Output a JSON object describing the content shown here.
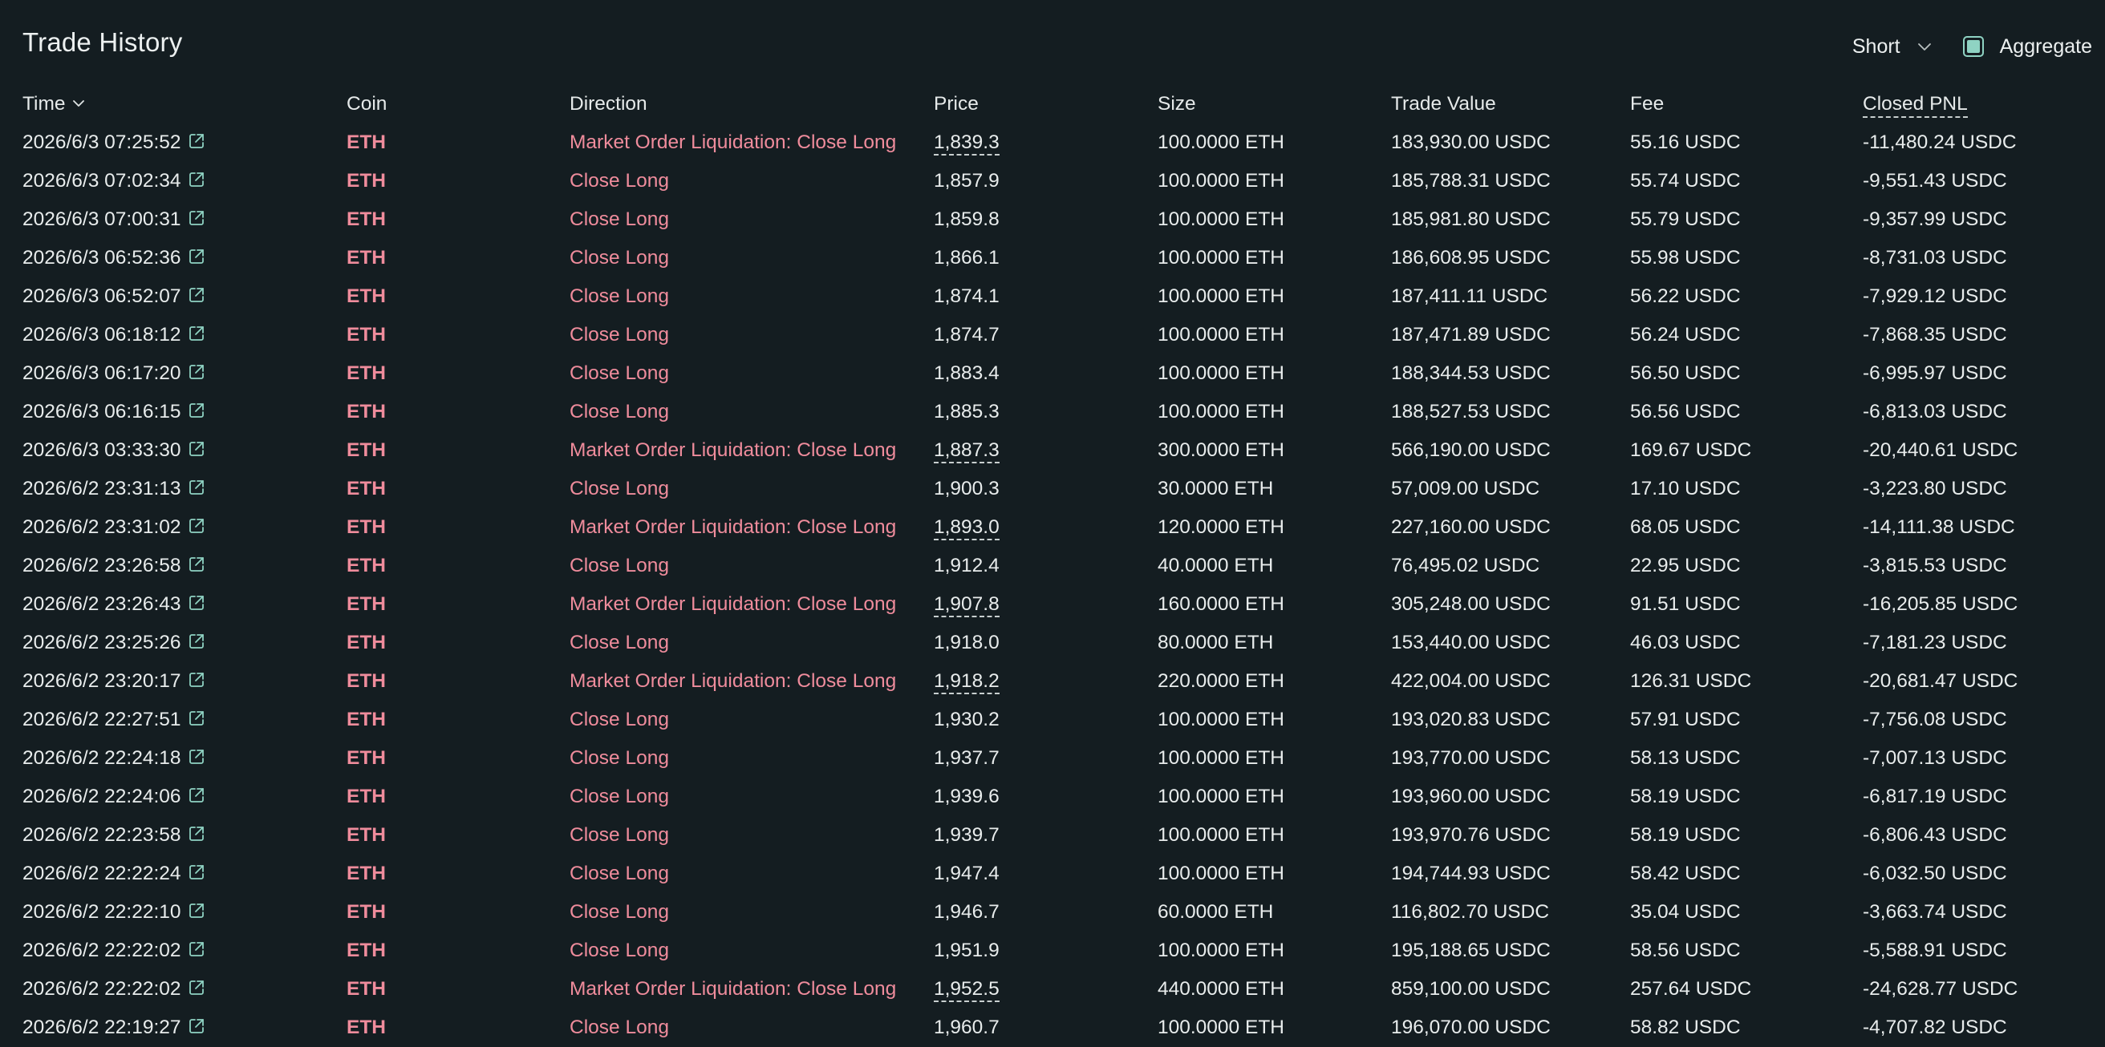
{
  "header": {
    "title": "Trade History",
    "direction_filter": "Short",
    "aggregate_label": "Aggregate",
    "aggregate_checked": true
  },
  "columns": {
    "time": "Time",
    "coin": "Coin",
    "direction": "Direction",
    "price": "Price",
    "size": "Size",
    "trade_value": "Trade Value",
    "fee": "Fee",
    "closed_pnl": "Closed PNL"
  },
  "colors": {
    "background": "#141d21",
    "accent": "#8fd3c3",
    "sell": "#ef8c9c",
    "text": "#e8ecec"
  },
  "rows": [
    {
      "time": "2026/6/3 07:25:52",
      "coin": "ETH",
      "direction": "Market Order Liquidation: Close Long",
      "price": "1,839.3",
      "liquidation": true,
      "size": "100.0000 ETH",
      "value": "183,930.00 USDC",
      "fee": "55.16 USDC",
      "pnl": "-11,480.24 USDC"
    },
    {
      "time": "2026/6/3 07:02:34",
      "coin": "ETH",
      "direction": "Close Long",
      "price": "1,857.9",
      "liquidation": false,
      "size": "100.0000 ETH",
      "value": "185,788.31 USDC",
      "fee": "55.74 USDC",
      "pnl": "-9,551.43 USDC"
    },
    {
      "time": "2026/6/3 07:00:31",
      "coin": "ETH",
      "direction": "Close Long",
      "price": "1,859.8",
      "liquidation": false,
      "size": "100.0000 ETH",
      "value": "185,981.80 USDC",
      "fee": "55.79 USDC",
      "pnl": "-9,357.99 USDC"
    },
    {
      "time": "2026/6/3 06:52:36",
      "coin": "ETH",
      "direction": "Close Long",
      "price": "1,866.1",
      "liquidation": false,
      "size": "100.0000 ETH",
      "value": "186,608.95 USDC",
      "fee": "55.98 USDC",
      "pnl": "-8,731.03 USDC"
    },
    {
      "time": "2026/6/3 06:52:07",
      "coin": "ETH",
      "direction": "Close Long",
      "price": "1,874.1",
      "liquidation": false,
      "size": "100.0000 ETH",
      "value": "187,411.11 USDC",
      "fee": "56.22 USDC",
      "pnl": "-7,929.12 USDC"
    },
    {
      "time": "2026/6/3 06:18:12",
      "coin": "ETH",
      "direction": "Close Long",
      "price": "1,874.7",
      "liquidation": false,
      "size": "100.0000 ETH",
      "value": "187,471.89 USDC",
      "fee": "56.24 USDC",
      "pnl": "-7,868.35 USDC"
    },
    {
      "time": "2026/6/3 06:17:20",
      "coin": "ETH",
      "direction": "Close Long",
      "price": "1,883.4",
      "liquidation": false,
      "size": "100.0000 ETH",
      "value": "188,344.53 USDC",
      "fee": "56.50 USDC",
      "pnl": "-6,995.97 USDC"
    },
    {
      "time": "2026/6/3 06:16:15",
      "coin": "ETH",
      "direction": "Close Long",
      "price": "1,885.3",
      "liquidation": false,
      "size": "100.0000 ETH",
      "value": "188,527.53 USDC",
      "fee": "56.56 USDC",
      "pnl": "-6,813.03 USDC"
    },
    {
      "time": "2026/6/3 03:33:30",
      "coin": "ETH",
      "direction": "Market Order Liquidation: Close Long",
      "price": "1,887.3",
      "liquidation": true,
      "size": "300.0000 ETH",
      "value": "566,190.00 USDC",
      "fee": "169.67 USDC",
      "pnl": "-20,440.61 USDC"
    },
    {
      "time": "2026/6/2 23:31:13",
      "coin": "ETH",
      "direction": "Close Long",
      "price": "1,900.3",
      "liquidation": false,
      "size": "30.0000 ETH",
      "value": "57,009.00 USDC",
      "fee": "17.10 USDC",
      "pnl": "-3,223.80 USDC"
    },
    {
      "time": "2026/6/2 23:31:02",
      "coin": "ETH",
      "direction": "Market Order Liquidation: Close Long",
      "price": "1,893.0",
      "liquidation": true,
      "size": "120.0000 ETH",
      "value": "227,160.00 USDC",
      "fee": "68.05 USDC",
      "pnl": "-14,111.38 USDC"
    },
    {
      "time": "2026/6/2 23:26:58",
      "coin": "ETH",
      "direction": "Close Long",
      "price": "1,912.4",
      "liquidation": false,
      "size": "40.0000 ETH",
      "value": "76,495.02 USDC",
      "fee": "22.95 USDC",
      "pnl": "-3,815.53 USDC"
    },
    {
      "time": "2026/6/2 23:26:43",
      "coin": "ETH",
      "direction": "Market Order Liquidation: Close Long",
      "price": "1,907.8",
      "liquidation": true,
      "size": "160.0000 ETH",
      "value": "305,248.00 USDC",
      "fee": "91.51 USDC",
      "pnl": "-16,205.85 USDC"
    },
    {
      "time": "2026/6/2 23:25:26",
      "coin": "ETH",
      "direction": "Close Long",
      "price": "1,918.0",
      "liquidation": false,
      "size": "80.0000 ETH",
      "value": "153,440.00 USDC",
      "fee": "46.03 USDC",
      "pnl": "-7,181.23 USDC"
    },
    {
      "time": "2026/6/2 23:20:17",
      "coin": "ETH",
      "direction": "Market Order Liquidation: Close Long",
      "price": "1,918.2",
      "liquidation": true,
      "size": "220.0000 ETH",
      "value": "422,004.00 USDC",
      "fee": "126.31 USDC",
      "pnl": "-20,681.47 USDC"
    },
    {
      "time": "2026/6/2 22:27:51",
      "coin": "ETH",
      "direction": "Close Long",
      "price": "1,930.2",
      "liquidation": false,
      "size": "100.0000 ETH",
      "value": "193,020.83 USDC",
      "fee": "57.91 USDC",
      "pnl": "-7,756.08 USDC"
    },
    {
      "time": "2026/6/2 22:24:18",
      "coin": "ETH",
      "direction": "Close Long",
      "price": "1,937.7",
      "liquidation": false,
      "size": "100.0000 ETH",
      "value": "193,770.00 USDC",
      "fee": "58.13 USDC",
      "pnl": "-7,007.13 USDC"
    },
    {
      "time": "2026/6/2 22:24:06",
      "coin": "ETH",
      "direction": "Close Long",
      "price": "1,939.6",
      "liquidation": false,
      "size": "100.0000 ETH",
      "value": "193,960.00 USDC",
      "fee": "58.19 USDC",
      "pnl": "-6,817.19 USDC"
    },
    {
      "time": "2026/6/2 22:23:58",
      "coin": "ETH",
      "direction": "Close Long",
      "price": "1,939.7",
      "liquidation": false,
      "size": "100.0000 ETH",
      "value": "193,970.76 USDC",
      "fee": "58.19 USDC",
      "pnl": "-6,806.43 USDC"
    },
    {
      "time": "2026/6/2 22:22:24",
      "coin": "ETH",
      "direction": "Close Long",
      "price": "1,947.4",
      "liquidation": false,
      "size": "100.0000 ETH",
      "value": "194,744.93 USDC",
      "fee": "58.42 USDC",
      "pnl": "-6,032.50 USDC"
    },
    {
      "time": "2026/6/2 22:22:10",
      "coin": "ETH",
      "direction": "Close Long",
      "price": "1,946.7",
      "liquidation": false,
      "size": "60.0000 ETH",
      "value": "116,802.70 USDC",
      "fee": "35.04 USDC",
      "pnl": "-3,663.74 USDC"
    },
    {
      "time": "2026/6/2 22:22:02",
      "coin": "ETH",
      "direction": "Close Long",
      "price": "1,951.9",
      "liquidation": false,
      "size": "100.0000 ETH",
      "value": "195,188.65 USDC",
      "fee": "58.56 USDC",
      "pnl": "-5,588.91 USDC"
    },
    {
      "time": "2026/6/2 22:22:02",
      "coin": "ETH",
      "direction": "Market Order Liquidation: Close Long",
      "price": "1,952.5",
      "liquidation": true,
      "size": "440.0000 ETH",
      "value": "859,100.00 USDC",
      "fee": "257.64 USDC",
      "pnl": "-24,628.77 USDC"
    },
    {
      "time": "2026/6/2 22:19:27",
      "coin": "ETH",
      "direction": "Close Long",
      "price": "1,960.7",
      "liquidation": false,
      "size": "100.0000 ETH",
      "value": "196,070.00 USDC",
      "fee": "58.82 USDC",
      "pnl": "-4,707.82 USDC"
    }
  ]
}
